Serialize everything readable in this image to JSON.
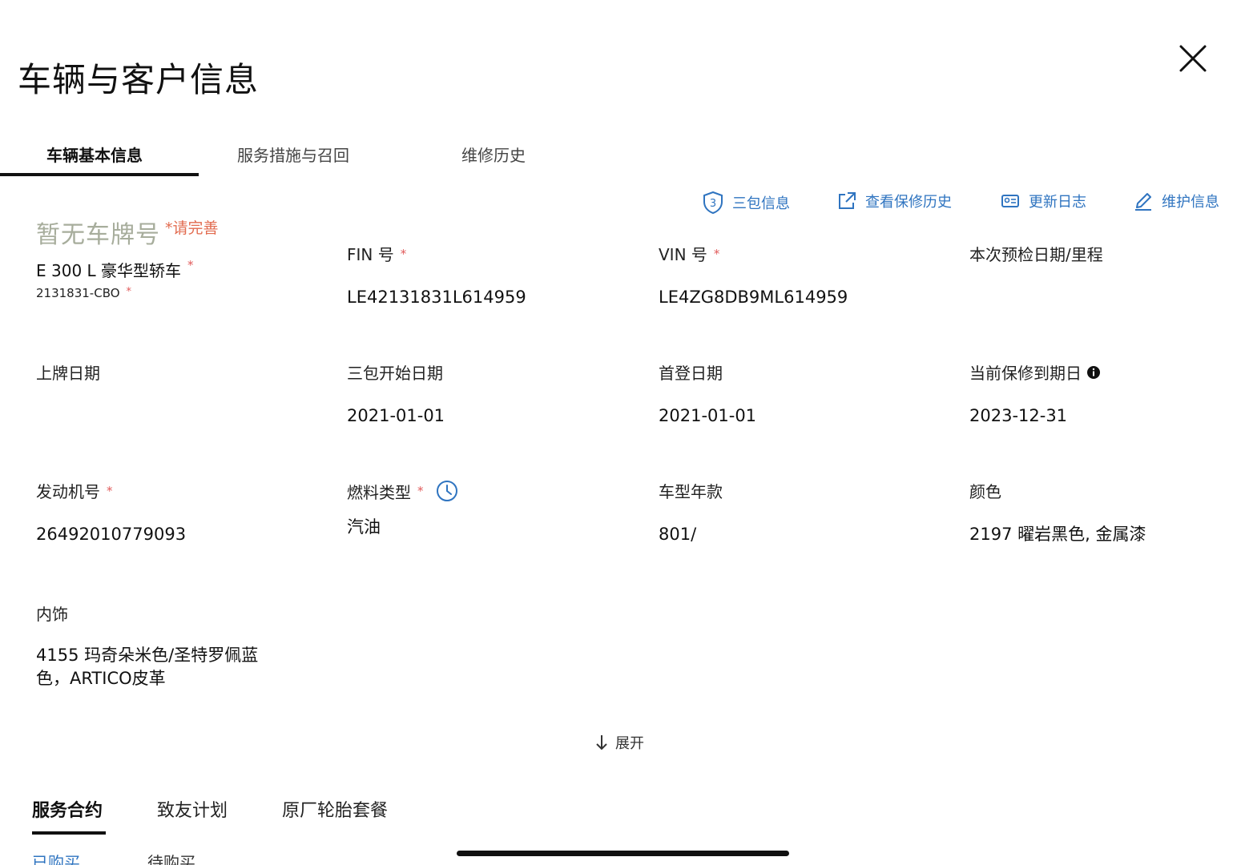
{
  "header": {
    "title": "车辆与客户信息"
  },
  "tabs": [
    {
      "label": "车辆基本信息",
      "active": true
    },
    {
      "label": "服务措施与召回",
      "active": false
    },
    {
      "label": "维修历史",
      "active": false
    }
  ],
  "actions": [
    {
      "label": "三包信息",
      "icon": "shield-3-icon"
    },
    {
      "label": "查看保修历史",
      "icon": "external-link-icon"
    },
    {
      "label": "更新日志",
      "icon": "log-card-icon"
    },
    {
      "label": "维护信息",
      "icon": "pencil-icon"
    }
  ],
  "vehicle": {
    "plate": "暂无车牌号",
    "plate_hint": "请完善",
    "model": "E 300 L 豪华型轿车",
    "model_code": "2131831-CBO",
    "required_mark": "*"
  },
  "fields": {
    "fin": {
      "label": "FIN 号",
      "value": "LE42131831L614959"
    },
    "vin": {
      "label": "VIN 号",
      "value": "LE4ZG8DB9ML614959"
    },
    "precheck": {
      "label": "本次预检日期/里程",
      "value": ""
    },
    "plate_date": {
      "label": "上牌日期",
      "value": ""
    },
    "warranty_start": {
      "label": "三包开始日期",
      "value": "2021-01-01"
    },
    "first_reg": {
      "label": "首登日期",
      "value": "2021-01-01"
    },
    "warranty_end": {
      "label": "当前保修到期日",
      "value": "2023-12-31"
    },
    "engine_no": {
      "label": "发动机号",
      "value": "26492010779093"
    },
    "fuel_type": {
      "label": "燃料类型",
      "value": "汽油"
    },
    "model_year": {
      "label": "车型年款",
      "value": "801/"
    },
    "color": {
      "label": "颜色",
      "value": "2197 曜岩黑色, 金属漆"
    },
    "interior": {
      "label": "内饰",
      "value": "4155 玛奇朵米色/圣特罗佩蓝色，ARTICO皮革"
    }
  },
  "expand": {
    "label": "展开"
  },
  "bottom_tabs": [
    {
      "label": "服务合约",
      "active": true
    },
    {
      "label": "致友计划",
      "active": false
    },
    {
      "label": "原厂轮胎套餐",
      "active": false
    }
  ],
  "sub_tabs": [
    {
      "label": "已购买",
      "active": true
    },
    {
      "label": "待购买",
      "active": false
    }
  ],
  "colors": {
    "accent": "#2f74c0",
    "required": "#e15a5a",
    "hint": "#e26b4f",
    "plate": "#a7ad9c"
  }
}
